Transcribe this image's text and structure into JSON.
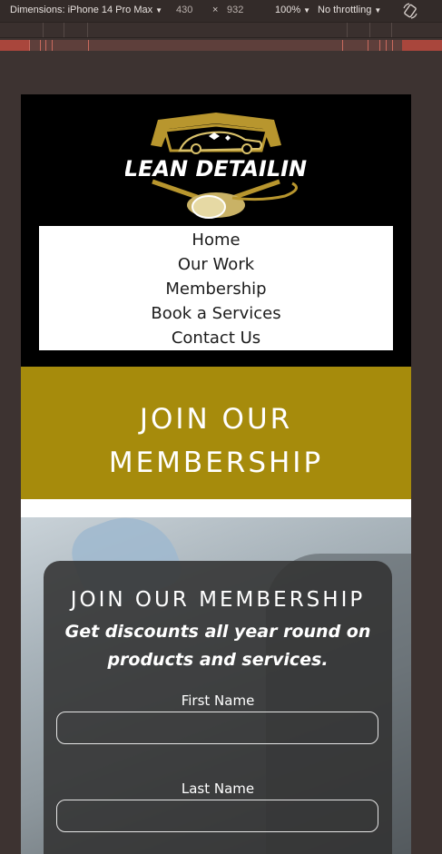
{
  "devtools": {
    "dimensions_label": "Dimensions: iPhone 14 Pro Max",
    "width_value": "430",
    "times": "×",
    "height_value": "932",
    "zoom_label": "100%",
    "throttle_label": "No throttling"
  },
  "site": {
    "logo_text": "KLEAN DETAILING",
    "nav": [
      "Home",
      "Our Work",
      "Membership",
      "Book a Services",
      "Contact Us"
    ],
    "banner_line1": "JOIN OUR",
    "banner_line2": "MEMBERSHIP",
    "colors": {
      "gold": "#a68b0c",
      "header_bg": "#000000"
    }
  },
  "form": {
    "title": "JOIN OUR MEMBERSHIP",
    "subtitle": "Get discounts all year round on products and services.",
    "first_name_label": "First Name",
    "first_name_value": "",
    "last_name_label": "Last Name",
    "last_name_value": ""
  }
}
